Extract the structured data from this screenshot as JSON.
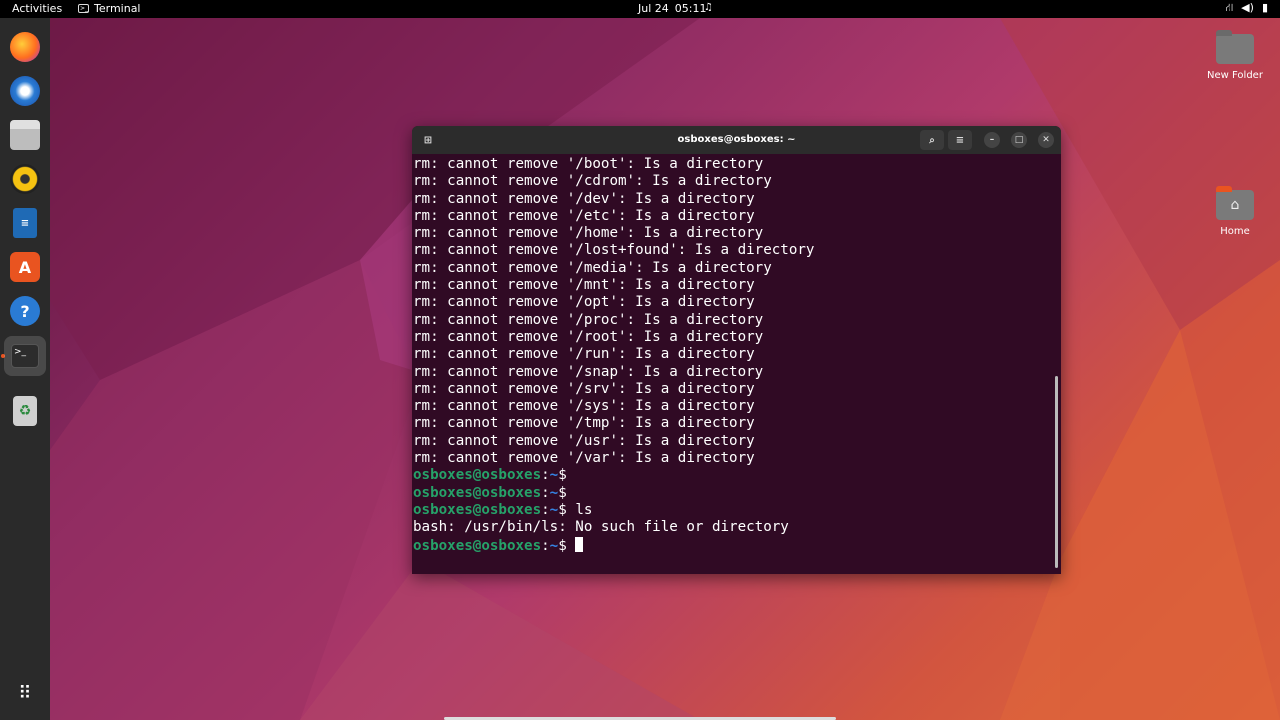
{
  "topbar": {
    "activities": "Activities",
    "app_name": "Terminal",
    "date": "Jul 24",
    "time": "05:11"
  },
  "desktop": {
    "icons": [
      {
        "label": "New Folder"
      },
      {
        "label": "Home"
      }
    ]
  },
  "terminal": {
    "title": "osboxes@osboxes: ~",
    "lines": [
      "rm: cannot remove '/boot': Is a directory",
      "rm: cannot remove '/cdrom': Is a directory",
      "rm: cannot remove '/dev': Is a directory",
      "rm: cannot remove '/etc': Is a directory",
      "rm: cannot remove '/home': Is a directory",
      "rm: cannot remove '/lost+found': Is a directory",
      "rm: cannot remove '/media': Is a directory",
      "rm: cannot remove '/mnt': Is a directory",
      "rm: cannot remove '/opt': Is a directory",
      "rm: cannot remove '/proc': Is a directory",
      "rm: cannot remove '/root': Is a directory",
      "rm: cannot remove '/run': Is a directory",
      "rm: cannot remove '/snap': Is a directory",
      "rm: cannot remove '/srv': Is a directory",
      "rm: cannot remove '/sys': Is a directory",
      "rm: cannot remove '/tmp': Is a directory",
      "rm: cannot remove '/usr': Is a directory",
      "rm: cannot remove '/var': Is a directory"
    ],
    "prompt_user": "osboxes@osboxes",
    "prompt_sep": ":",
    "prompt_path": "~",
    "prompt_symbol": "$",
    "commands": [
      {
        "cmd": "",
        "output": ""
      },
      {
        "cmd": "",
        "output": ""
      },
      {
        "cmd": "ls",
        "output": "bash: /usr/bin/ls: No such file or directory"
      },
      {
        "cmd": "",
        "output": ""
      }
    ]
  },
  "colors": {
    "terminal_bg": "#300a24",
    "prompt_user": "#26a269",
    "prompt_path": "#3584e4",
    "accent": "#e95420"
  }
}
